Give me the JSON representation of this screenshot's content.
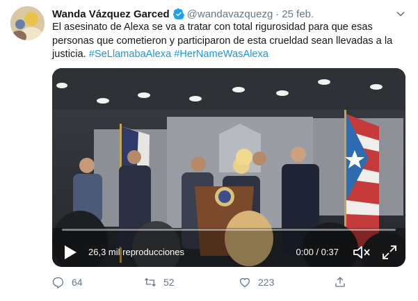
{
  "tweet": {
    "author_name": "Wanda Vázquez Garced",
    "handle": "@wandavazquezg",
    "separator": "·",
    "date": "25 feb.",
    "text_plain": "El asesinato de Alexa se va a tratar con total rigurosidad para que esas personas que cometieron y participaron de esta crueldad sean llevadas a la justicia.",
    "hashtag_1": "#SeLlamabaAlexa",
    "hashtag_2": "#HerNameWasAlexa"
  },
  "video": {
    "views": "26,3 mil reproducciones",
    "time": "0:00 / 0:37",
    "progress": 0
  },
  "actions": {
    "replies": "64",
    "retweets": "52",
    "likes": "223"
  },
  "colors": {
    "link": "#1b95e0",
    "muted": "#657786",
    "verified": "#1da1f2"
  }
}
